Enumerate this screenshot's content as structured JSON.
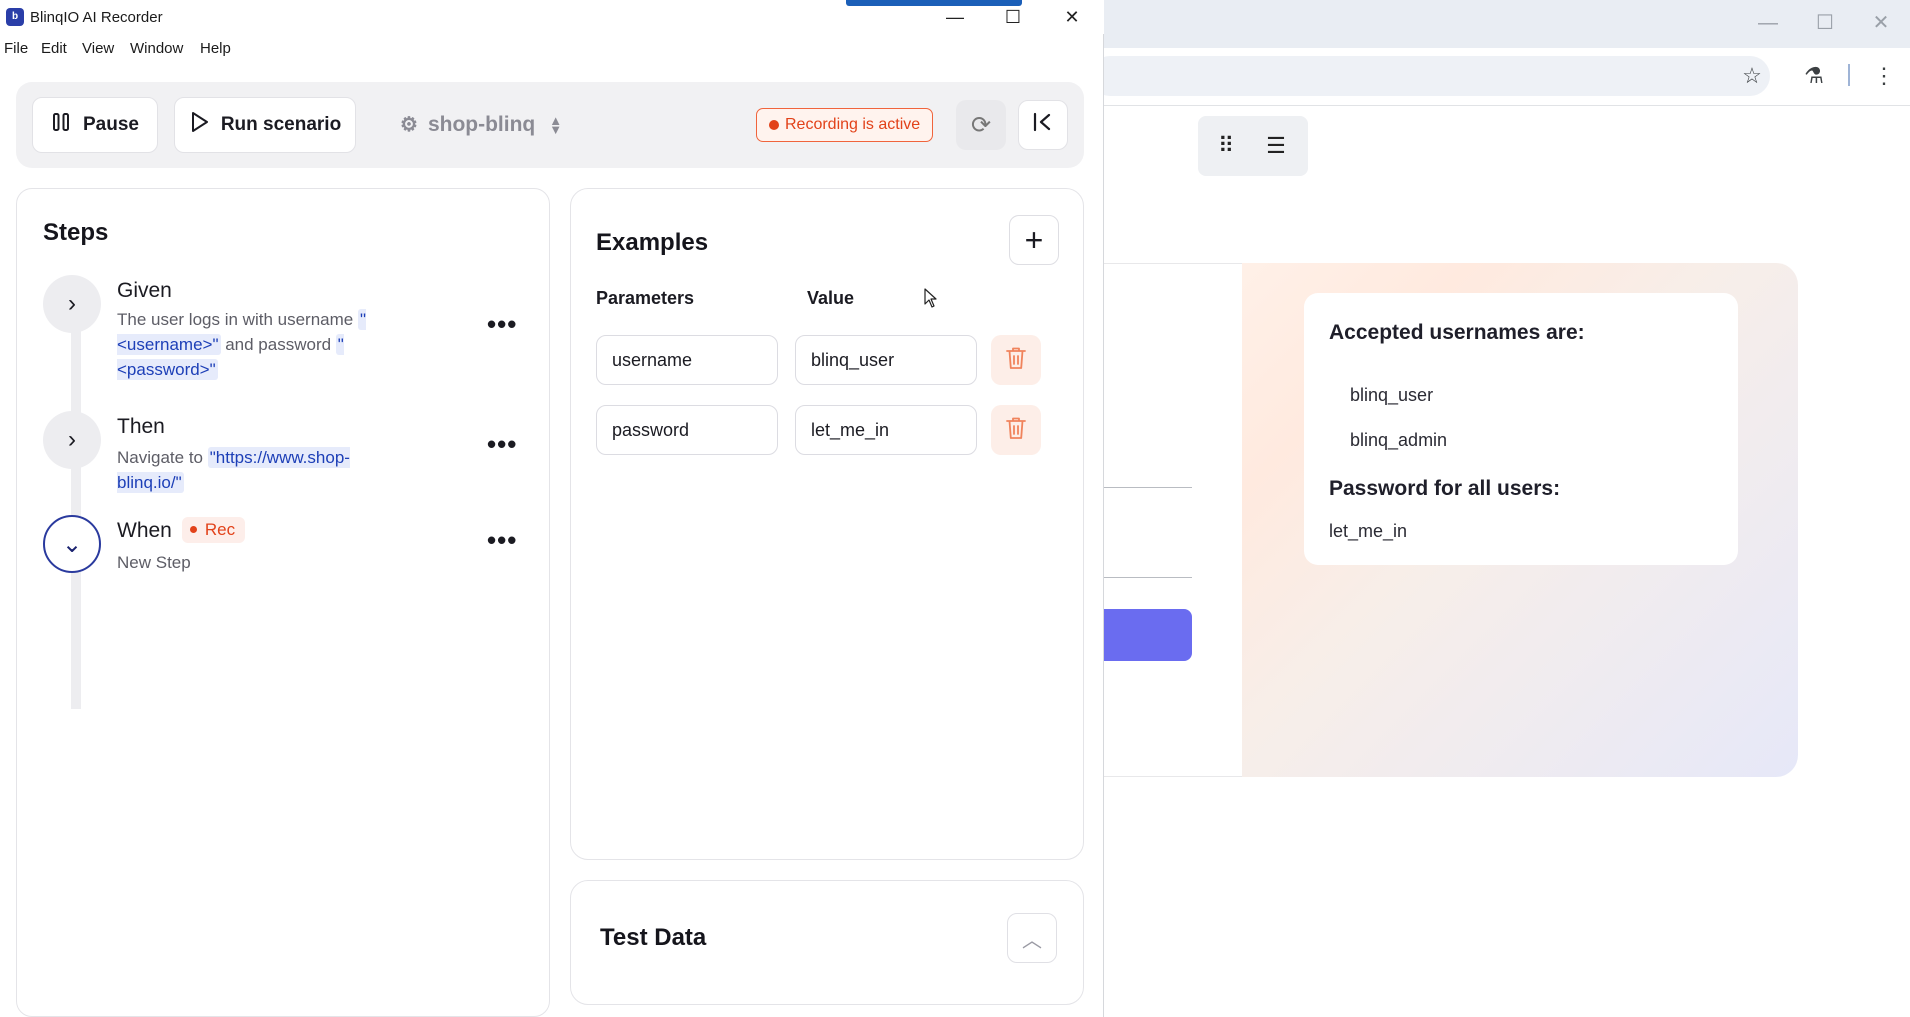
{
  "app": {
    "title": "BlinqIO AI Recorder",
    "logo_glyph": "b",
    "menu": [
      "File",
      "Edit",
      "View",
      "Window",
      "Help"
    ],
    "window_controls": {
      "minimize": "—",
      "maximize": "☐",
      "close": "✕"
    }
  },
  "toolbar": {
    "pause_label": "Pause",
    "run_label": "Run scenario",
    "project_name": "shop-blinq",
    "recording_status": "Recording is active"
  },
  "steps": {
    "title": "Steps",
    "items": [
      {
        "keyword": "Given",
        "text_before": "The user logs in with username ",
        "param1": "\"<username>\"",
        "text_middle": " and password ",
        "param2": "\"<password>\"",
        "state": "collapsed"
      },
      {
        "keyword": "Then",
        "text_before": "Navigate to ",
        "param1": "\"https://www.shop-blinq.io/\"",
        "state": "collapsed"
      },
      {
        "keyword": "When",
        "badge": "Rec",
        "text": "New Step",
        "state": "expanded"
      }
    ]
  },
  "examples": {
    "title": "Examples",
    "col_parameters": "Parameters",
    "col_value": "Value",
    "rows": [
      {
        "parameter": "username",
        "value": "blinq_user"
      },
      {
        "parameter": "password",
        "value": "let_me_in"
      }
    ]
  },
  "test_data": {
    "title": "Test Data"
  },
  "webpage": {
    "accepted_title": "Accepted usernames are:",
    "usernames": [
      "blinq_user",
      "blinq_admin"
    ],
    "password_title": "Password for all users:",
    "password": "let_me_in"
  },
  "colors": {
    "accent_recording": "#e2421a",
    "param_token": "#1d3fb7",
    "active_step_ring": "#2a3a9e",
    "login_button": "#6a6cf0"
  }
}
